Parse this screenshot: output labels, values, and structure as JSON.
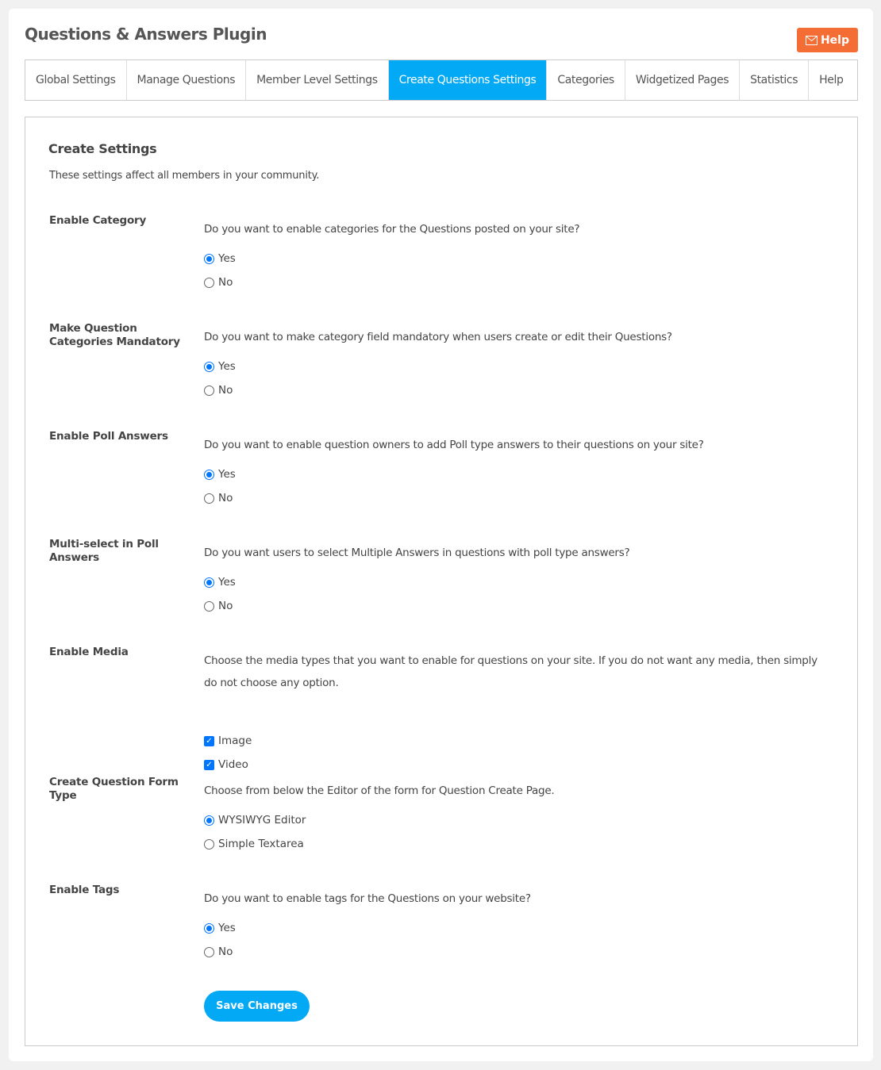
{
  "header": {
    "title": "Questions & Answers Plugin",
    "help_label": "Help",
    "help_color": "#f36d35"
  },
  "tabs": [
    {
      "label": "Global Settings",
      "active": false
    },
    {
      "label": "Manage Questions",
      "active": false
    },
    {
      "label": "Member Level Settings",
      "active": false
    },
    {
      "label": "Create Questions Settings",
      "active": true
    },
    {
      "label": "Categories",
      "active": false
    },
    {
      "label": "Widgetized Pages",
      "active": false
    },
    {
      "label": "Statistics",
      "active": false
    },
    {
      "label": "Help",
      "active": false
    }
  ],
  "form": {
    "title": "Create Settings",
    "description": "These settings affect all members in your community.",
    "sections": [
      {
        "label": "Enable Category",
        "question": "Do you want to enable categories for the Questions posted on your site?",
        "type": "radio",
        "options": [
          {
            "label": "Yes",
            "checked": true
          },
          {
            "label": "No",
            "checked": false
          }
        ]
      },
      {
        "label": "Make Question Categories Mandatory",
        "question": "Do you want to make category field mandatory when users create or edit their Questions?",
        "type": "radio",
        "options": [
          {
            "label": "Yes",
            "checked": true
          },
          {
            "label": "No",
            "checked": false
          }
        ]
      },
      {
        "label": "Enable Poll Answers",
        "question": "Do you want to enable question owners to add Poll type answers to their questions on your site?",
        "type": "radio",
        "options": [
          {
            "label": "Yes",
            "checked": true
          },
          {
            "label": "No",
            "checked": false
          }
        ]
      },
      {
        "label": "Multi-select in Poll Answers",
        "question": "Do you want users to select Multiple Answers in questions with poll type answers?",
        "type": "radio",
        "options": [
          {
            "label": "Yes",
            "checked": true
          },
          {
            "label": "No",
            "checked": false
          }
        ]
      },
      {
        "label": "Enable Media",
        "question": "Choose the media types that you want to enable for questions on your site. If you do not want any media, then simply do not choose any option.",
        "type": "checkbox",
        "options": [
          {
            "label": "Image",
            "checked": true
          },
          {
            "label": "Video",
            "checked": true
          }
        ]
      },
      {
        "label": "Create Question Form Type",
        "question": "Choose from below the Editor of the form for Question Create Page.",
        "type": "radio",
        "options": [
          {
            "label": "WYSIWYG Editor",
            "checked": true
          },
          {
            "label": "Simple Textarea",
            "checked": false
          }
        ]
      },
      {
        "label": "Enable Tags",
        "question": "Do you want to enable tags for the Questions on your website?",
        "type": "radio",
        "options": [
          {
            "label": "Yes",
            "checked": true
          },
          {
            "label": "No",
            "checked": false
          }
        ]
      }
    ],
    "save_label": "Save Changes"
  },
  "colors": {
    "accent": "#03a9f4",
    "radio": "#0075ff"
  }
}
